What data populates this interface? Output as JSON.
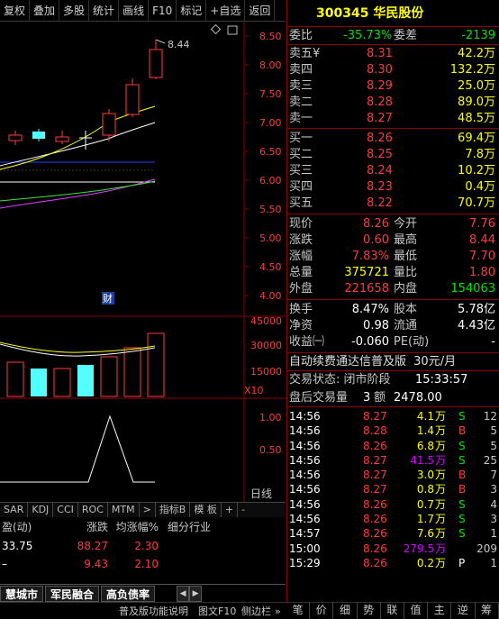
{
  "toolbar": [
    "复权",
    "叠加",
    "多股",
    "统计",
    "画线",
    "F10",
    "标记",
    "+自选",
    "返回"
  ],
  "kline": {
    "price_labels": [
      "8.50",
      "8.00",
      "7.50",
      "7.00",
      "6.50",
      "6.00",
      "5.50",
      "5.00",
      "4.50",
      "4.00"
    ],
    "high_marker": "8.44",
    "finance_marker": "财"
  },
  "volume": {
    "labels": [
      "45000",
      "30000",
      "15000"
    ],
    "unit": "X10"
  },
  "indicator": {
    "labels": [
      "1.00",
      "0.50"
    ]
  },
  "panel_tag": "日线",
  "indicator_tabs": [
    "SAR",
    "KDJ",
    "CCI",
    "ROC",
    "MTM",
    ">",
    "指标B",
    "模 板",
    "+",
    "-"
  ],
  "fin_table": {
    "headers": [
      "盈(动)",
      "涨跌",
      "均涨幅%",
      "细分行业"
    ],
    "rows": [
      [
        "33.75",
        "88.27",
        "2.30",
        ""
      ],
      [
        "–",
        "9.43",
        "2.10",
        ""
      ]
    ]
  },
  "sector_tabs": [
    "慧城市",
    "军民融合",
    "高负债率"
  ],
  "status_bar": [
    "普及版功能说明",
    "图文F10",
    "侧边栏",
    "»"
  ],
  "stock": {
    "code": "300345",
    "name": "华民股份"
  },
  "weibi": {
    "label": "委比",
    "value": "-35.73%",
    "label2": "委差",
    "value2": "-2139"
  },
  "asks": [
    {
      "label": "卖五",
      "flag": "¥",
      "price": "8.31",
      "vol": "42.2万"
    },
    {
      "label": "卖四",
      "flag": "",
      "price": "8.30",
      "vol": "132.2万"
    },
    {
      "label": "卖三",
      "flag": "",
      "price": "8.29",
      "vol": "25.0万"
    },
    {
      "label": "卖二",
      "flag": "",
      "price": "8.28",
      "vol": "89.0万"
    },
    {
      "label": "卖一",
      "flag": "",
      "price": "8.27",
      "vol": "48.5万"
    }
  ],
  "bids": [
    {
      "label": "买一",
      "price": "8.26",
      "vol": "69.4万"
    },
    {
      "label": "买二",
      "price": "8.25",
      "vol": "7.8万"
    },
    {
      "label": "买三",
      "price": "8.24",
      "vol": "10.2万"
    },
    {
      "label": "买四",
      "price": "8.23",
      "vol": "0.4万"
    },
    {
      "label": "买五",
      "price": "8.22",
      "vol": "70.7万"
    }
  ],
  "quote": [
    {
      "l1": "现价",
      "v1": "8.26",
      "c1": "red",
      "l2": "今开",
      "v2": "7.76",
      "c2": "red"
    },
    {
      "l1": "涨跌",
      "v1": "0.60",
      "c1": "red",
      "l2": "最高",
      "v2": "8.44",
      "c2": "red"
    },
    {
      "l1": "涨幅",
      "v1": "7.83%",
      "c1": "red",
      "l2": "最低",
      "v2": "7.70",
      "c2": "red"
    },
    {
      "l1": "总量",
      "v1": "375721",
      "c1": "yellow",
      "l2": "量比",
      "v2": "1.80",
      "c2": "red"
    },
    {
      "l1": "外盘",
      "v1": "221658",
      "c1": "red",
      "l2": "内盘",
      "v2": "154063",
      "c2": "green"
    }
  ],
  "fundamentals": [
    {
      "l1": "换手",
      "v1": "8.47%",
      "l2": "股本",
      "v2": "5.78亿"
    },
    {
      "l1": "净资",
      "v1": "0.98",
      "l2": "流通",
      "v2": "4.43亿"
    },
    {
      "l1": "收益㈠",
      "v1": "-0.060",
      "l2": "PE(动)",
      "v2": "-"
    }
  ],
  "ad": {
    "text": "自动续费通达信普及版",
    "price": "30元/月"
  },
  "trade_status": {
    "label": "交易状态: 闭市阶段",
    "time": "15:33:57"
  },
  "after_hours": {
    "label": "盘后交易量",
    "count": "3",
    "label2": "额",
    "amount": "2478.00"
  },
  "trades": [
    {
      "time": "14:56",
      "price": "8.27",
      "vol": "4.1",
      "unit": "万",
      "side": "S",
      "cnt": "12",
      "big": false
    },
    {
      "time": "14:56",
      "price": "8.28",
      "vol": "1.4",
      "unit": "万",
      "side": "B",
      "cnt": "5",
      "big": false
    },
    {
      "time": "14:56",
      "price": "8.26",
      "vol": "6.8",
      "unit": "万",
      "side": "S",
      "cnt": "5",
      "big": false
    },
    {
      "time": "14:56",
      "price": "8.27",
      "vol": "41.5",
      "unit": "万",
      "side": "S",
      "cnt": "25",
      "big": true
    },
    {
      "time": "14:56",
      "price": "8.27",
      "vol": "3.0",
      "unit": "万",
      "side": "B",
      "cnt": "7",
      "big": false
    },
    {
      "time": "14:56",
      "price": "8.27",
      "vol": "0.8",
      "unit": "万",
      "side": "B",
      "cnt": "3",
      "big": false
    },
    {
      "time": "14:56",
      "price": "8.26",
      "vol": "0.7",
      "unit": "万",
      "side": "S",
      "cnt": "4",
      "big": false
    },
    {
      "time": "14:56",
      "price": "8.26",
      "vol": "1.7",
      "unit": "万",
      "side": "S",
      "cnt": "3",
      "big": false
    },
    {
      "time": "14:57",
      "price": "8.26",
      "vol": "7.6",
      "unit": "万",
      "side": "S",
      "cnt": "1",
      "big": false
    },
    {
      "time": "15:00",
      "price": "8.26",
      "vol": "279.5",
      "unit": "万",
      "side": "",
      "cnt": "209",
      "big": true
    },
    {
      "time": "15:29",
      "price": "8.26",
      "vol": "0.2",
      "unit": "万",
      "side": "P",
      "cnt": "1",
      "big": false
    }
  ],
  "bottom_tabs": [
    "笔",
    "价",
    "细",
    "势",
    "联",
    "值",
    "主",
    "逆",
    "筹"
  ],
  "colors": {
    "up": "#ff3a3a",
    "down": "#00e000",
    "flat_candle": "#54ffff",
    "panel_border": "#8b0000",
    "big_order": "#d000ff"
  }
}
